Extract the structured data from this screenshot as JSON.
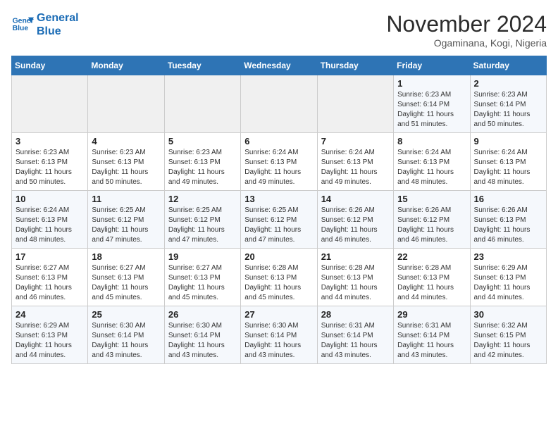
{
  "logo": {
    "line1": "General",
    "line2": "Blue"
  },
  "title": "November 2024",
  "subtitle": "Ogaminana, Kogi, Nigeria",
  "weekdays": [
    "Sunday",
    "Monday",
    "Tuesday",
    "Wednesday",
    "Thursday",
    "Friday",
    "Saturday"
  ],
  "weeks": [
    [
      {
        "day": "",
        "info": ""
      },
      {
        "day": "",
        "info": ""
      },
      {
        "day": "",
        "info": ""
      },
      {
        "day": "",
        "info": ""
      },
      {
        "day": "",
        "info": ""
      },
      {
        "day": "1",
        "info": "Sunrise: 6:23 AM\nSunset: 6:14 PM\nDaylight: 11 hours and 51 minutes."
      },
      {
        "day": "2",
        "info": "Sunrise: 6:23 AM\nSunset: 6:14 PM\nDaylight: 11 hours and 50 minutes."
      }
    ],
    [
      {
        "day": "3",
        "info": "Sunrise: 6:23 AM\nSunset: 6:13 PM\nDaylight: 11 hours and 50 minutes."
      },
      {
        "day": "4",
        "info": "Sunrise: 6:23 AM\nSunset: 6:13 PM\nDaylight: 11 hours and 50 minutes."
      },
      {
        "day": "5",
        "info": "Sunrise: 6:23 AM\nSunset: 6:13 PM\nDaylight: 11 hours and 49 minutes."
      },
      {
        "day": "6",
        "info": "Sunrise: 6:24 AM\nSunset: 6:13 PM\nDaylight: 11 hours and 49 minutes."
      },
      {
        "day": "7",
        "info": "Sunrise: 6:24 AM\nSunset: 6:13 PM\nDaylight: 11 hours and 49 minutes."
      },
      {
        "day": "8",
        "info": "Sunrise: 6:24 AM\nSunset: 6:13 PM\nDaylight: 11 hours and 48 minutes."
      },
      {
        "day": "9",
        "info": "Sunrise: 6:24 AM\nSunset: 6:13 PM\nDaylight: 11 hours and 48 minutes."
      }
    ],
    [
      {
        "day": "10",
        "info": "Sunrise: 6:24 AM\nSunset: 6:13 PM\nDaylight: 11 hours and 48 minutes."
      },
      {
        "day": "11",
        "info": "Sunrise: 6:25 AM\nSunset: 6:12 PM\nDaylight: 11 hours and 47 minutes."
      },
      {
        "day": "12",
        "info": "Sunrise: 6:25 AM\nSunset: 6:12 PM\nDaylight: 11 hours and 47 minutes."
      },
      {
        "day": "13",
        "info": "Sunrise: 6:25 AM\nSunset: 6:12 PM\nDaylight: 11 hours and 47 minutes."
      },
      {
        "day": "14",
        "info": "Sunrise: 6:26 AM\nSunset: 6:12 PM\nDaylight: 11 hours and 46 minutes."
      },
      {
        "day": "15",
        "info": "Sunrise: 6:26 AM\nSunset: 6:12 PM\nDaylight: 11 hours and 46 minutes."
      },
      {
        "day": "16",
        "info": "Sunrise: 6:26 AM\nSunset: 6:13 PM\nDaylight: 11 hours and 46 minutes."
      }
    ],
    [
      {
        "day": "17",
        "info": "Sunrise: 6:27 AM\nSunset: 6:13 PM\nDaylight: 11 hours and 46 minutes."
      },
      {
        "day": "18",
        "info": "Sunrise: 6:27 AM\nSunset: 6:13 PM\nDaylight: 11 hours and 45 minutes."
      },
      {
        "day": "19",
        "info": "Sunrise: 6:27 AM\nSunset: 6:13 PM\nDaylight: 11 hours and 45 minutes."
      },
      {
        "day": "20",
        "info": "Sunrise: 6:28 AM\nSunset: 6:13 PM\nDaylight: 11 hours and 45 minutes."
      },
      {
        "day": "21",
        "info": "Sunrise: 6:28 AM\nSunset: 6:13 PM\nDaylight: 11 hours and 44 minutes."
      },
      {
        "day": "22",
        "info": "Sunrise: 6:28 AM\nSunset: 6:13 PM\nDaylight: 11 hours and 44 minutes."
      },
      {
        "day": "23",
        "info": "Sunrise: 6:29 AM\nSunset: 6:13 PM\nDaylight: 11 hours and 44 minutes."
      }
    ],
    [
      {
        "day": "24",
        "info": "Sunrise: 6:29 AM\nSunset: 6:13 PM\nDaylight: 11 hours and 44 minutes."
      },
      {
        "day": "25",
        "info": "Sunrise: 6:30 AM\nSunset: 6:14 PM\nDaylight: 11 hours and 43 minutes."
      },
      {
        "day": "26",
        "info": "Sunrise: 6:30 AM\nSunset: 6:14 PM\nDaylight: 11 hours and 43 minutes."
      },
      {
        "day": "27",
        "info": "Sunrise: 6:30 AM\nSunset: 6:14 PM\nDaylight: 11 hours and 43 minutes."
      },
      {
        "day": "28",
        "info": "Sunrise: 6:31 AM\nSunset: 6:14 PM\nDaylight: 11 hours and 43 minutes."
      },
      {
        "day": "29",
        "info": "Sunrise: 6:31 AM\nSunset: 6:14 PM\nDaylight: 11 hours and 43 minutes."
      },
      {
        "day": "30",
        "info": "Sunrise: 6:32 AM\nSunset: 6:15 PM\nDaylight: 11 hours and 42 minutes."
      }
    ]
  ]
}
